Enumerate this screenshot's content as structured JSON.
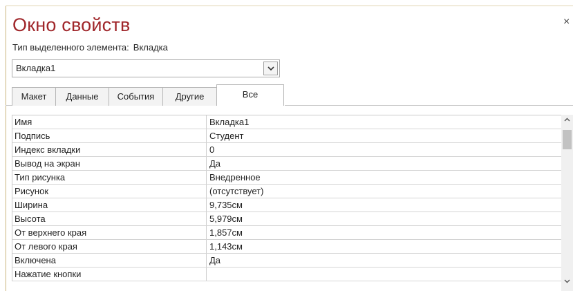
{
  "window": {
    "title": "Окно свойств",
    "close_glyph": "×"
  },
  "selection": {
    "type_label": "Тип выделенного элемента:",
    "type_value": "Вкладка",
    "selected_object": "Вкладка1"
  },
  "tabs": [
    {
      "label": "Макет",
      "active": false
    },
    {
      "label": "Данные",
      "active": false
    },
    {
      "label": "События",
      "active": false
    },
    {
      "label": "Другие",
      "active": false
    },
    {
      "label": "Все",
      "active": true
    }
  ],
  "properties": [
    {
      "name": "Имя",
      "value": "Вкладка1"
    },
    {
      "name": "Подпись",
      "value": "Студент"
    },
    {
      "name": "Индекс вкладки",
      "value": "0"
    },
    {
      "name": "Вывод на экран",
      "value": "Да"
    },
    {
      "name": "Тип рисунка",
      "value": "Внедренное"
    },
    {
      "name": "Рисунок",
      "value": "(отсутствует)"
    },
    {
      "name": "Ширина",
      "value": "9,735см"
    },
    {
      "name": "Высота",
      "value": "5,979см"
    },
    {
      "name": "От верхнего края",
      "value": "1,857см"
    },
    {
      "name": "От левого края",
      "value": "1,143см"
    },
    {
      "name": "Включена",
      "value": "Да"
    },
    {
      "name": "Нажатие кнопки",
      "value": ""
    }
  ],
  "colors": {
    "title": "#a0272b",
    "pane_border": "#c9b27a"
  },
  "icons": {
    "dropdown": "chevron-down-icon",
    "scroll_up": "scroll-up-arrow-icon",
    "scroll_down": "scroll-down-arrow-icon",
    "close": "close-icon"
  }
}
